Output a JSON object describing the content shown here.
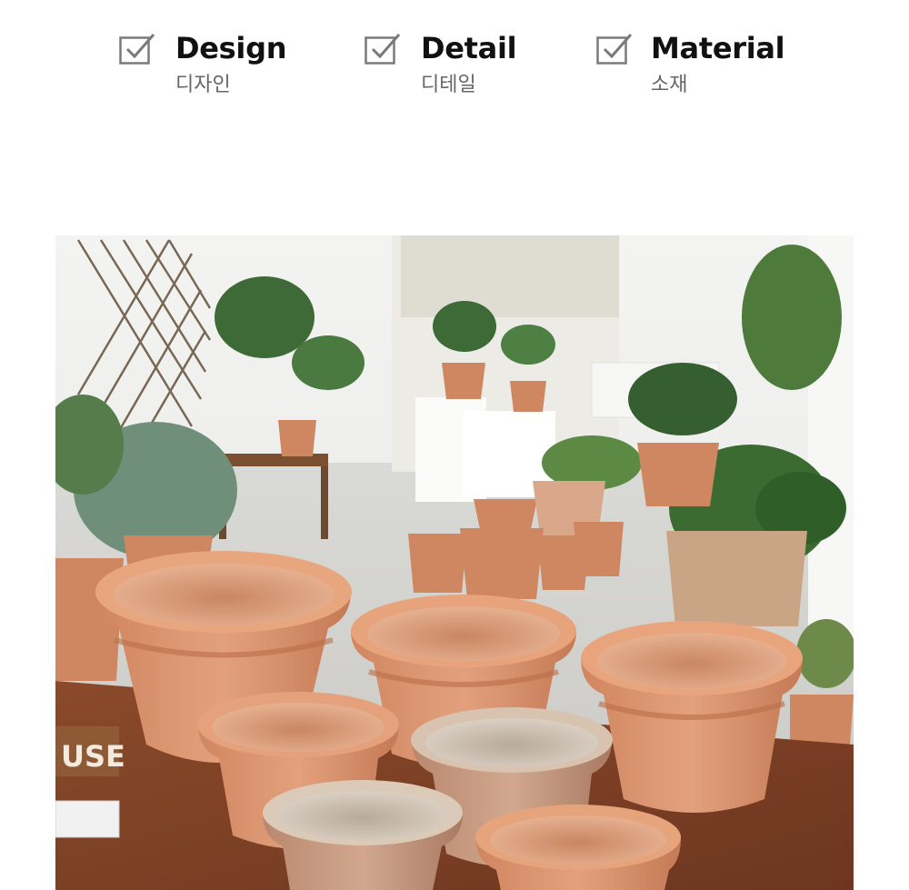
{
  "features": [
    {
      "title": "Design",
      "subtitle": "디자인",
      "icon": "checked-box-icon"
    },
    {
      "title": "Detail",
      "subtitle": "디테일",
      "icon": "checked-box-icon"
    },
    {
      "title": "Material",
      "subtitle": "소재",
      "icon": "checked-box-icon"
    }
  ],
  "photo": {
    "sign_text": "USE"
  },
  "colors": {
    "title": "#111111",
    "subtitle": "#666666",
    "icon": "#7a7a7a",
    "terracotta": "#d98f6a"
  }
}
